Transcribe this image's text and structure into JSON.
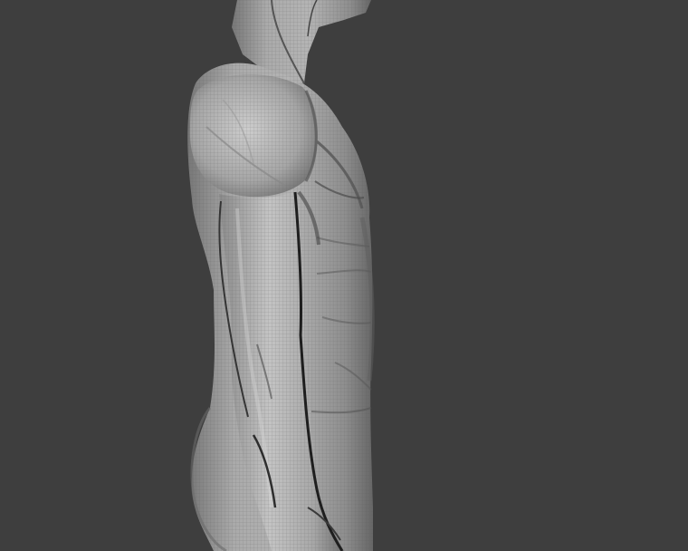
{
  "viewport": {
    "background": "#3e3e3e",
    "mesh_color": "#9a9a9a",
    "mesh_highlight": "#c9c9c9",
    "mesh_shadow": "#6a6a6a",
    "crease_color": "#1e1e1e"
  },
  "model": {
    "icon": "sculpt-mesh-icon"
  }
}
